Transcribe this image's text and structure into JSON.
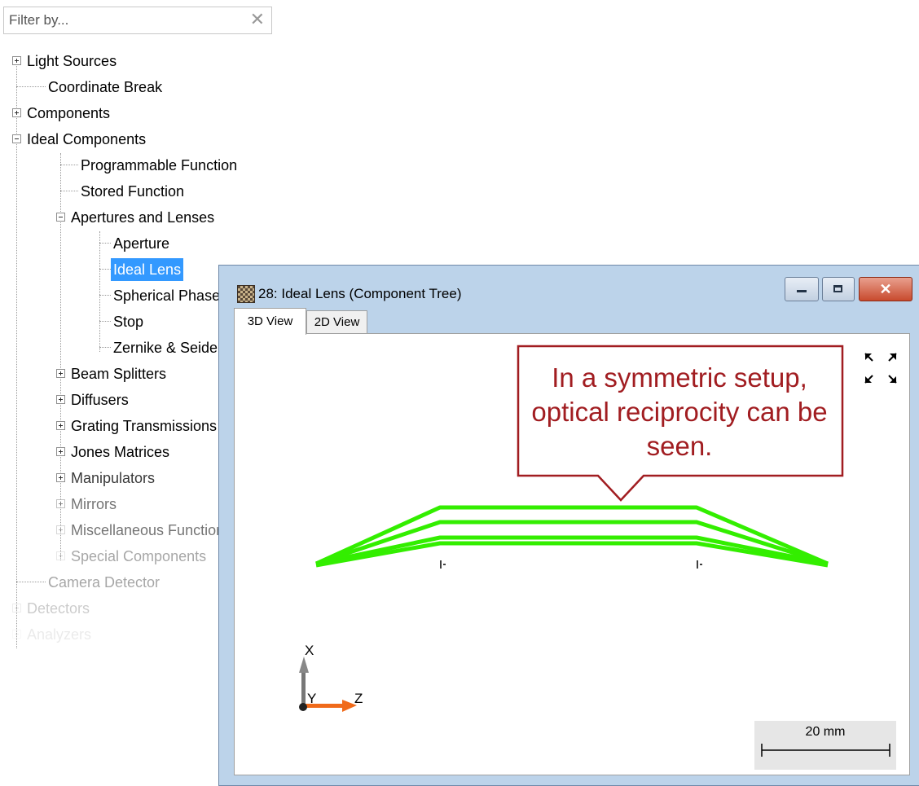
{
  "filter": {
    "placeholder": "Filter by..."
  },
  "tree": {
    "light_sources": "Light Sources",
    "coordinate_break": "Coordinate Break",
    "components": "Components",
    "ideal_components": "Ideal Components",
    "programmable_function": "Programmable Function",
    "stored_function": "Stored Function",
    "apertures_and_lenses": "Apertures and Lenses",
    "aperture": "Aperture",
    "ideal_lens": "Ideal Lens",
    "spherical_phase": "Spherical Phase",
    "stop": "Stop",
    "zernike_seidel": "Zernike & Seidel Aberrations",
    "beam_splitters": "Beam Splitters",
    "diffusers": "Diffusers",
    "grating_transmissions": "Grating Transmissions",
    "jones_matrices": "Jones Matrices",
    "manipulators": "Manipulators",
    "mirrors": "Mirrors",
    "miscellaneous_functions": "Miscellaneous Functions",
    "special_components": "Special Components",
    "camera_detector": "Camera Detector",
    "detectors": "Detectors",
    "analyzers": "Analyzers"
  },
  "window": {
    "title": "28: Ideal Lens (Component Tree)",
    "close_glyph": "✕",
    "tabs": {
      "view_3d": "3D View",
      "view_2d": "2D View"
    }
  },
  "viewport": {
    "callout": "In a symmetric setup, optical reciprocity can be seen.",
    "axis_x": "X",
    "axis_y": "Y",
    "axis_z": "Z",
    "scale_label": "20 mm",
    "ray_color": "#33ee00",
    "callout_color": "#a11d21"
  }
}
